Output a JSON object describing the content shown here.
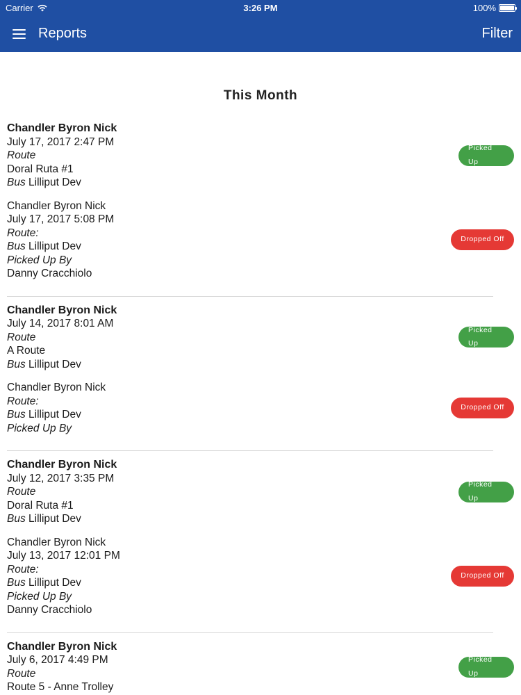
{
  "status_bar": {
    "carrier": "Carrier",
    "time": "3:26 PM",
    "battery": "100%",
    "battery_level": 1.0
  },
  "nav": {
    "title": "Reports",
    "filter_label": "Filter"
  },
  "section_title": "This Month",
  "colors": {
    "nav_bg": "#1f4fa3",
    "picked_up": "#43a047",
    "dropped_off": "#e53935"
  },
  "groups": [
    {
      "records": [
        {
          "name": "Chandler Byron Nick",
          "datetime": "July 17, 2017 2:47 PM",
          "route_label": "Route",
          "route_value": "Doral Ruta #1",
          "bus_label": "Bus",
          "bus_value": "Lilliput Dev",
          "status": "Picked Up"
        },
        {
          "name": "Chandler Byron Nick",
          "datetime": "July 17, 2017 5:08 PM",
          "route_label": "Route:",
          "bus_label": "Bus",
          "bus_value": "Lilliput Dev",
          "picked_by_label": "Picked Up By",
          "picked_by_value": "Danny Cracchiolo",
          "status": "Dropped Off"
        }
      ]
    },
    {
      "records": [
        {
          "name": "Chandler Byron Nick",
          "datetime": "July 14, 2017 8:01 AM",
          "route_label": "Route",
          "route_value": "A Route",
          "bus_label": "Bus",
          "bus_value": "Lilliput Dev",
          "status": "Picked Up"
        },
        {
          "name": "Chandler Byron Nick",
          "route_label": "Route:",
          "bus_label": "Bus",
          "bus_value": "Lilliput Dev",
          "picked_by_label": "Picked Up By",
          "status": "Dropped Off"
        }
      ]
    },
    {
      "records": [
        {
          "name": "Chandler Byron Nick",
          "datetime": "July 12, 2017 3:35 PM",
          "route_label": "Route",
          "route_value": "Doral Ruta #1",
          "bus_label": "Bus",
          "bus_value": "Lilliput Dev",
          "status": "Picked Up"
        },
        {
          "name": "Chandler Byron Nick",
          "datetime": "July 13, 2017 12:01 PM",
          "route_label": "Route:",
          "bus_label": "Bus",
          "bus_value": "Lilliput Dev",
          "picked_by_label": "Picked Up By",
          "picked_by_value": "Danny Cracchiolo",
          "status": "Dropped Off"
        }
      ]
    },
    {
      "records": [
        {
          "name": "Chandler Byron Nick",
          "datetime": "July 6, 2017 4:49 PM",
          "route_label": "Route",
          "route_value": "Route 5 - Anne Trolley",
          "status": "Picked Up"
        }
      ]
    }
  ]
}
